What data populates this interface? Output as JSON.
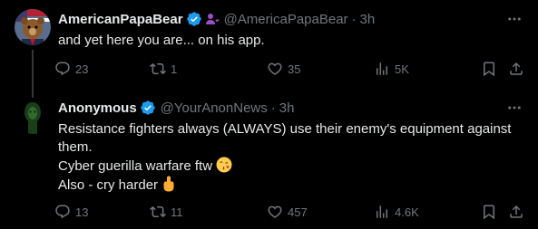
{
  "tweets": [
    {
      "author_name": "AmericanPapaBear",
      "handle": "@AmericaPapaBear",
      "separator": "·",
      "time": "3h",
      "text_lines": [
        "and yet here you are... on his app."
      ],
      "stats": {
        "replies": "23",
        "retweets": "1",
        "likes": "35",
        "views": "5K"
      }
    },
    {
      "author_name": "Anonymous",
      "handle": "@YourAnonNews",
      "separator": "·",
      "time": "3h",
      "text_lines": [
        "Resistance fighters always (ALWAYS) use their enemy's equipment against",
        "them.",
        "Cyber guerilla warfare ftw",
        "Also - cry harder"
      ],
      "stats": {
        "replies": "13",
        "retweets": "11",
        "likes": "457",
        "views": "4.6K"
      }
    }
  ],
  "colors": {
    "background": "#000000",
    "text_primary": "#e7e9ea",
    "text_secondary": "#71767b",
    "verified_blue": "#1d9bf0",
    "affiliate_purple": "#9b4dca"
  },
  "icons": {
    "reply": "speech-bubble",
    "retweet": "retweet-arrows",
    "like": "heart-outline",
    "views": "bar-chart",
    "bookmark": "bookmark",
    "share": "upload-arrow",
    "more": "three-dots"
  }
}
